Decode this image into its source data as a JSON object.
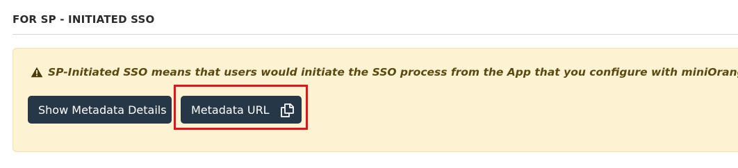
{
  "section": {
    "title": "FOR SP - INITIATED SSO"
  },
  "notice": {
    "icon": "warning-icon",
    "text": "SP-Initiated SSO means that users would initiate the SSO process from the App that you configure with miniOrange",
    "background_color": "#fdf3d2",
    "text_color": "#5a4a12"
  },
  "buttons": {
    "show_metadata_label": "Show Metadata Details",
    "metadata_url_label": "Metadata URL",
    "metadata_url_icon": "copy-icon",
    "background_color": "#263747"
  },
  "highlight": {
    "color": "#e0141c"
  }
}
